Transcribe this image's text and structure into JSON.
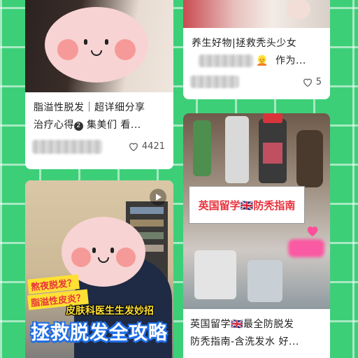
{
  "feed": {
    "card1": {
      "title_line1": "脂溢性脱发｜超详细分享",
      "title_line2_pre": "治疗心得",
      "title_line2_badge": "2",
      "title_line2_post": "集美们 看...",
      "likes": "4421"
    },
    "card2": {
      "title_line1": "养生好物|拯救秃头少女",
      "title_line2_post": "作为...",
      "likes": "5"
    },
    "card3": {
      "overlay_line1": "熬夜脱发？",
      "overlay_line2": "脂溢性皮炎？",
      "overlay_line3": "皮肤科医生生发妙招",
      "overlay_big": "拯救脱发全攻略"
    },
    "card4": {
      "banner": "英国留学🇬🇧防秃指南",
      "title_line1": "英国留学🇬🇧最全防脱发",
      "title_line2": "防秃指南-含洗发水 好..."
    }
  },
  "colors": {
    "background": "#3ccf78",
    "accent_red": "#e8323c",
    "blue": "#1e6ee8",
    "yellow": "#ffe033"
  }
}
